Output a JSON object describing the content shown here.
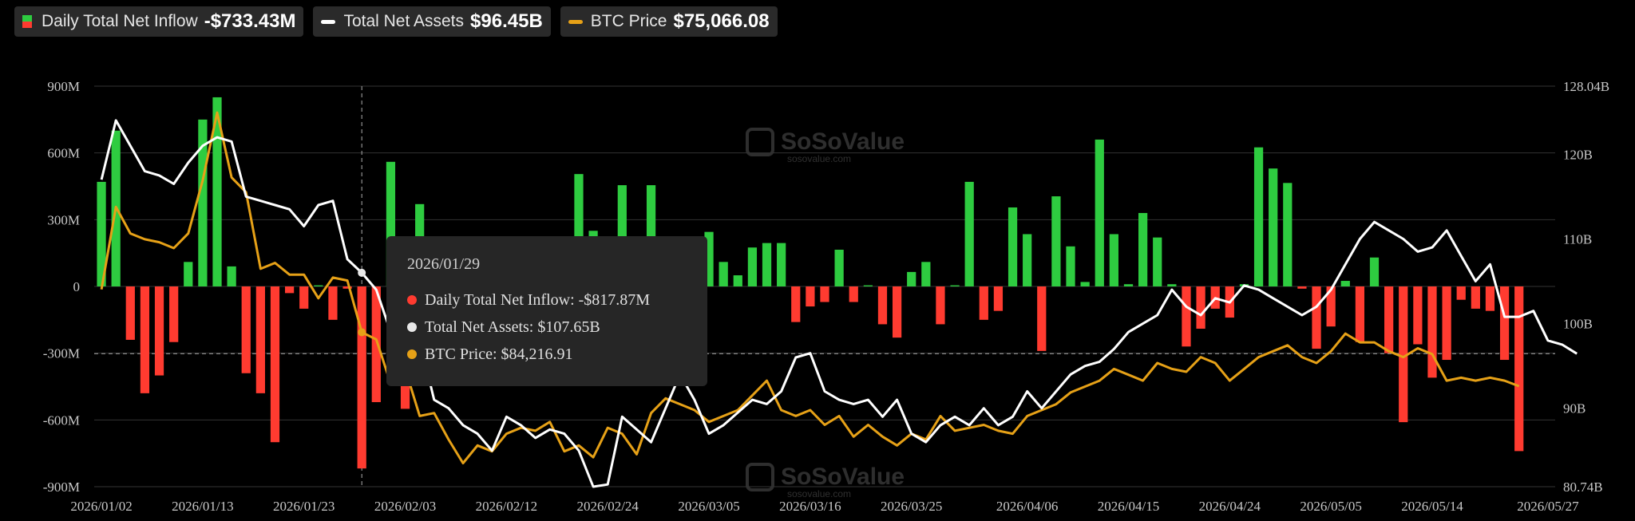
{
  "legend": {
    "inflow_label": "Daily Total Net Inflow",
    "inflow_value": "-$733.43M",
    "assets_label": "Total Net Assets",
    "assets_value": "$96.45B",
    "btc_label": "BTC Price",
    "btc_value": "$75,066.08"
  },
  "colors": {
    "inflow_pos": "#2ecc40",
    "inflow_neg": "#ff3b30",
    "assets": "#ffffff",
    "btc": "#e6a117"
  },
  "watermark": {
    "name": "SoSoValue",
    "url": "sosovalue.com"
  },
  "tooltip": {
    "date": "2026/01/29",
    "inflow": "Daily Total Net Inflow: -$817.87M",
    "assets": "Total Net Assets: $107.65B",
    "btc": "BTC Price: $84,216.91"
  },
  "chart_data": {
    "type": "bar",
    "categories": [
      "2026/01/02",
      "2026/01/05",
      "2026/01/06",
      "2026/01/07",
      "2026/01/08",
      "2026/01/09",
      "2026/01/12",
      "2026/01/13",
      "2026/01/14",
      "2026/01/15",
      "2026/01/16",
      "2026/01/20",
      "2026/01/21",
      "2026/01/22",
      "2026/01/23",
      "2026/01/26",
      "2026/01/27",
      "2026/01/28",
      "2026/01/29",
      "2026/01/30",
      "2026/02/02",
      "2026/02/03",
      "2026/02/04",
      "2026/02/05",
      "2026/02/06",
      "2026/02/09",
      "2026/02/10",
      "2026/02/11",
      "2026/02/12",
      "2026/02/13",
      "2026/02/17",
      "2026/02/18",
      "2026/02/19",
      "2026/02/20",
      "2026/02/23",
      "2026/02/24",
      "2026/02/25",
      "2026/02/26",
      "2026/02/27",
      "2026/03/02",
      "2026/03/03",
      "2026/03/04",
      "2026/03/05",
      "2026/03/06",
      "2026/03/09",
      "2026/03/10",
      "2026/03/11",
      "2026/03/12",
      "2026/03/13",
      "2026/03/16",
      "2026/03/17",
      "2026/03/18",
      "2026/03/19",
      "2026/03/20",
      "2026/03/23",
      "2026/03/24",
      "2026/03/25",
      "2026/03/26",
      "2026/03/27",
      "2026/03/30",
      "2026/03/31",
      "2026/04/01",
      "2026/04/02",
      "2026/04/03",
      "2026/04/06",
      "2026/04/07",
      "2026/04/08",
      "2026/04/09",
      "2026/04/10",
      "2026/04/13",
      "2026/04/14",
      "2026/04/15",
      "2026/04/16",
      "2026/04/17",
      "2026/04/20",
      "2026/04/21",
      "2026/04/22",
      "2026/04/23",
      "2026/04/24",
      "2026/04/27",
      "2026/04/28",
      "2026/04/29",
      "2026/04/30",
      "2026/05/01",
      "2026/05/04",
      "2026/05/05",
      "2026/05/06",
      "2026/05/07",
      "2026/05/08",
      "2026/05/11",
      "2026/05/12",
      "2026/05/13",
      "2026/05/14",
      "2026/05/15",
      "2026/05/18",
      "2026/05/19",
      "2026/05/20",
      "2026/05/21",
      "2026/05/22",
      "2026/05/26",
      "2026/05/27"
    ],
    "x_tick_labels": [
      "2026/01/02",
      "2026/01/13",
      "2026/01/23",
      "2026/02/03",
      "2026/02/12",
      "2026/02/24",
      "2026/03/05",
      "2026/03/16",
      "2026/03/25",
      "2026/04/06",
      "2026/04/15",
      "2026/04/24",
      "2026/05/05",
      "2026/05/14",
      "2026/05/27"
    ],
    "y_left_ticks": [
      "900M",
      "600M",
      "300M",
      "0",
      "-300M",
      "-600M",
      "-900M"
    ],
    "y_right_ticks": [
      "128.04B",
      "120B",
      "110B",
      "100B",
      "90B",
      "80.74B"
    ],
    "ylim_left": [
      -900,
      900
    ],
    "ylim_right": [
      80.74,
      128.04
    ],
    "crosshair_category": "2026/01/29",
    "reference_line_assets": 96.45,
    "series": [
      {
        "name": "Daily Total Net Inflow",
        "type": "bar",
        "unit": "M",
        "values": [
          470,
          700,
          -240,
          -480,
          -400,
          -250,
          110,
          750,
          850,
          90,
          -390,
          -480,
          -700,
          -30,
          -100,
          5,
          -150,
          -10,
          -818,
          -520,
          560,
          -550,
          370,
          -200,
          -100,
          -50,
          -30,
          -20,
          -40,
          -20,
          -30,
          -100,
          -50,
          505,
          250,
          -150,
          455,
          -100,
          455,
          -220,
          -350,
          160,
          245,
          110,
          50,
          175,
          195,
          195,
          -160,
          -90,
          -70,
          165,
          -70,
          5,
          -170,
          -230,
          65,
          110,
          -170,
          5,
          470,
          -150,
          -110,
          355,
          235,
          -290,
          405,
          180,
          20,
          660,
          235,
          10,
          330,
          220,
          10,
          -270,
          -190,
          -100,
          -140,
          10,
          625,
          530,
          465,
          -10,
          -280,
          -180,
          25,
          -250,
          130,
          -300,
          -610,
          -260,
          -410,
          -330,
          -60,
          -100,
          -110,
          -330,
          -740
        ]
      },
      {
        "name": "Total Net Assets",
        "type": "line",
        "unit": "B",
        "values": [
          117,
          124,
          121,
          118,
          117.5,
          116.5,
          119,
          121,
          122,
          121.5,
          115,
          114.5,
          114,
          113.5,
          111.5,
          114,
          114.5,
          107.6,
          106,
          104,
          99,
          101,
          98,
          91,
          90,
          88,
          87,
          85,
          89,
          88,
          86.5,
          87.5,
          87,
          85,
          80.74,
          81,
          89,
          87.5,
          86,
          90,
          94,
          91,
          87,
          88,
          89.5,
          91,
          90.5,
          92,
          96,
          96.5,
          92,
          91,
          90.5,
          91,
          89,
          91,
          87,
          86,
          88,
          89,
          88,
          90,
          88,
          89,
          92,
          90,
          92,
          94,
          95,
          95.5,
          97,
          99,
          100,
          101,
          104,
          102,
          101,
          103,
          102.5,
          104.5,
          104,
          103,
          102,
          101,
          102,
          104,
          107,
          110,
          112,
          111,
          110,
          108.5,
          109,
          111,
          108,
          105,
          107,
          100.8,
          100.8,
          101.5,
          98,
          97.5,
          96.45
        ]
      },
      {
        "name": "BTC Price",
        "type": "line",
        "unit": "$",
        "values": [
          91500,
          105500,
          101000,
          100000,
          99500,
          98500,
          101000,
          110000,
          121500,
          110500,
          108000,
          95000,
          96000,
          94000,
          94000,
          90000,
          93500,
          93000,
          84217,
          83000,
          75500,
          78000,
          70000,
          70500,
          66000,
          62000,
          65000,
          64000,
          67000,
          68000,
          67500,
          69000,
          64000,
          65000,
          63000,
          68000,
          67000,
          63500,
          70500,
          73000,
          72000,
          71000,
          69000,
          70000,
          71000,
          73500,
          76000,
          71000,
          70000,
          71000,
          68500,
          70000,
          66500,
          68500,
          66500,
          65000,
          67000,
          66000,
          70000,
          67500,
          68000,
          68500,
          67500,
          67000,
          70000,
          71000,
          72000,
          74000,
          75000,
          76000,
          78000,
          77000,
          76000,
          79000,
          78000,
          77500,
          80000,
          79000,
          76000,
          78000,
          80000,
          81000,
          82000,
          80000,
          79000,
          81000,
          84000,
          82500,
          82500,
          81000,
          80000,
          81500,
          80500,
          76000,
          76500,
          76000,
          76500,
          76000,
          75066
        ],
        "note_scale": "BTC Price plotted on its own hidden scale"
      }
    ]
  }
}
